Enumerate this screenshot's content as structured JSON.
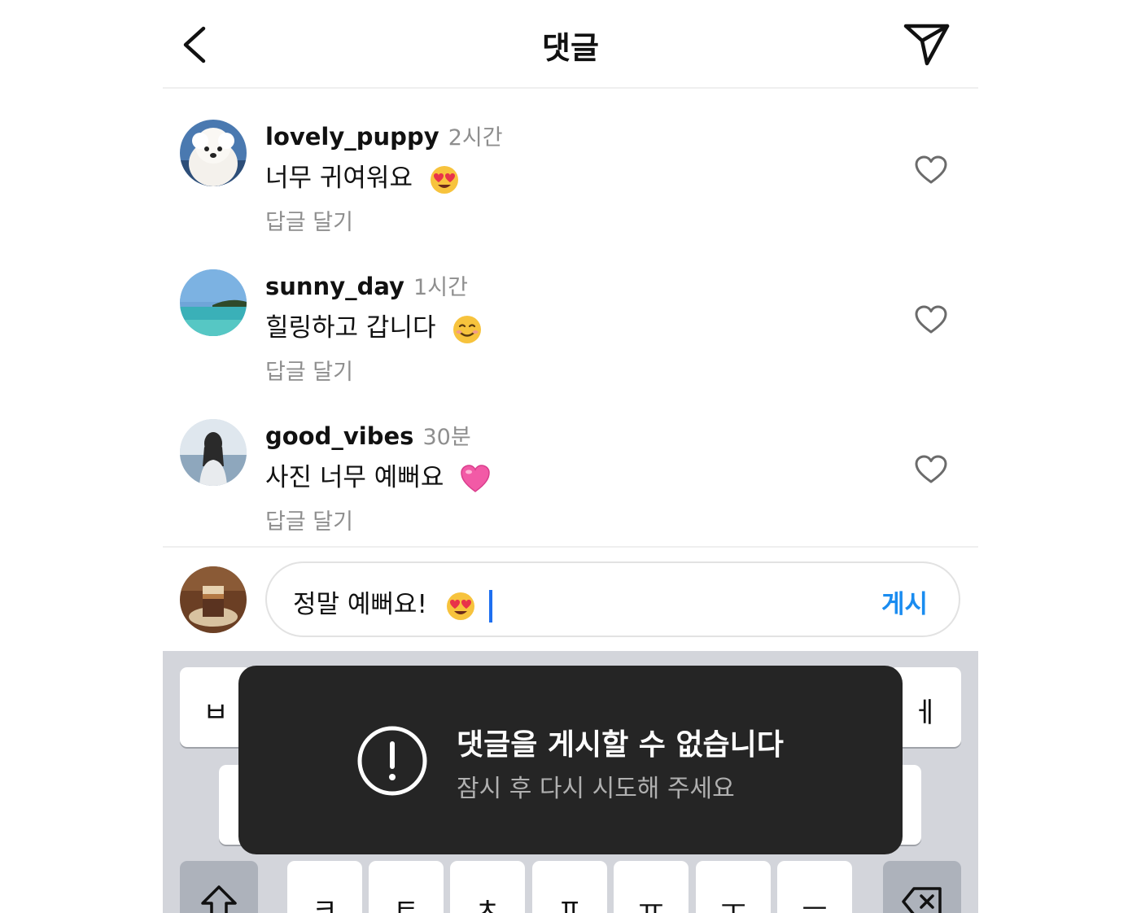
{
  "header": {
    "title": "댓글",
    "icons": {
      "back": "chevron-left-icon",
      "send": "paper-plane-icon"
    }
  },
  "comments": [
    {
      "user": "lovely_puppy",
      "time": "2시간",
      "text": "너무 귀여워요",
      "emoji": "heart-eyes-emoji",
      "reply": "답글 달기",
      "avatar": "puppy-avatar"
    },
    {
      "user": "sunny_day",
      "time": "1시간",
      "text": "힐링하고 갑니다",
      "emoji": "smiling-face-emoji",
      "reply": "답글 달기",
      "avatar": "beach-avatar"
    },
    {
      "user": "good_vibes",
      "time": "30분",
      "text": "사진 너무 예뻐요",
      "emoji": "pink-heart-emoji",
      "reply": "답글 달기",
      "avatar": "woman-seaside-avatar"
    }
  ],
  "composer": {
    "value": "정말 예뻐요!",
    "emoji": "heart-eyes-emoji",
    "post_label": "게시",
    "avatar": "coffee-avatar"
  },
  "keyboard": {
    "row1_left": "ㅂ",
    "row1_right": "ㅔ",
    "row3": [
      "ㅋ",
      "ㅌ",
      "ㅊ",
      "ㅍ",
      "ㅠ",
      "ㅜ",
      "ㅡ"
    ],
    "icons": {
      "shift": "shift-arrow-icon",
      "delete": "backspace-icon"
    }
  },
  "toast": {
    "title": "댓글을 게시할 수 없습니다",
    "subtitle": "잠시 후 다시 시도해 주세요",
    "icon": "exclamation-circle-icon"
  },
  "colors": {
    "accent": "#1a8cf0",
    "caret": "#1e6ff0",
    "toast_bg": "#252525",
    "muted_text": "#8e8e8e",
    "keyboard_bg": "#d3d5db"
  }
}
